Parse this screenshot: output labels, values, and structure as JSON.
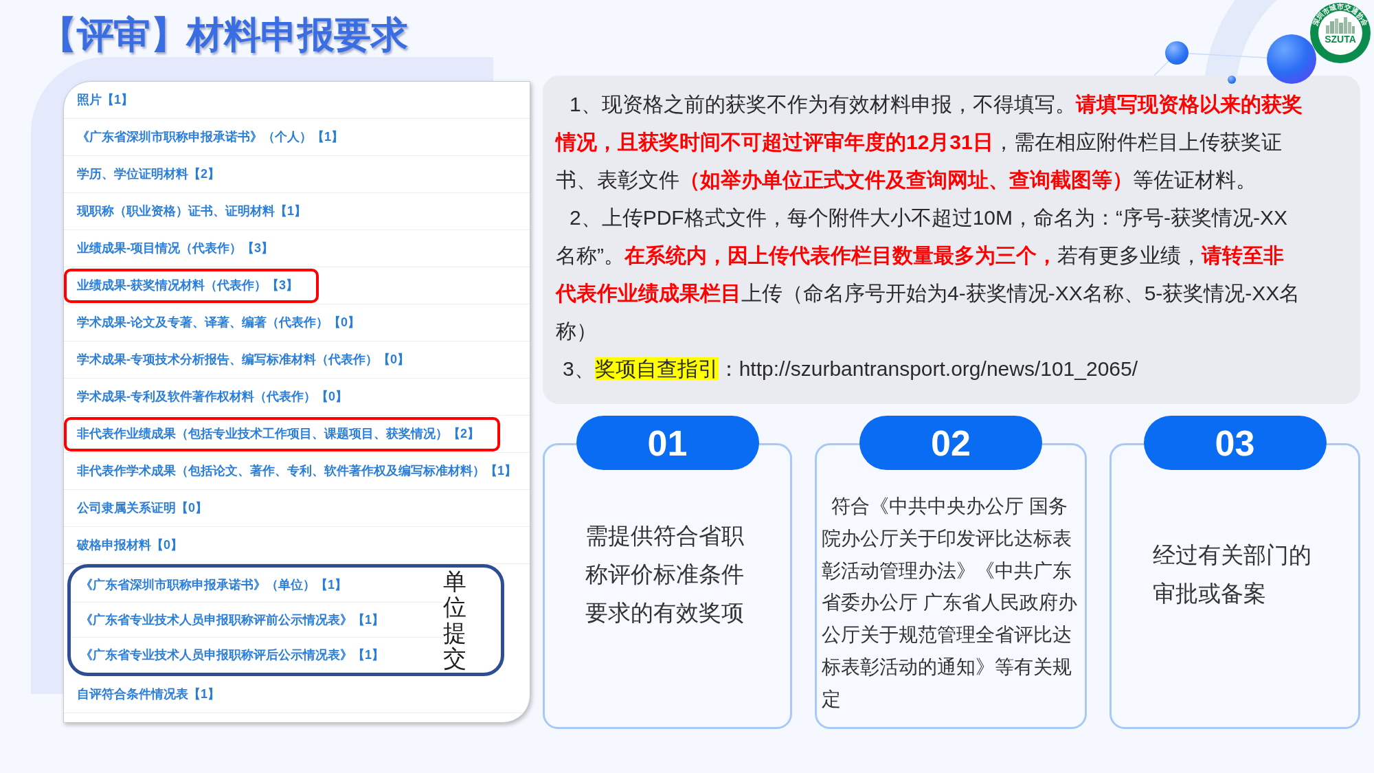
{
  "title": "【评审】材料申报要求",
  "logo": {
    "name": "深圳市城市交通协会",
    "abbreviation": "SZUTA"
  },
  "attachment_list": {
    "items": [
      {
        "kind": "row",
        "text": "照片【1】",
        "highlighted": false
      },
      {
        "kind": "row",
        "text": "《广东省深圳市职称申报承诺书》（个人）【1】",
        "highlighted": false
      },
      {
        "kind": "row",
        "text": "学历、学位证明材料【2】",
        "highlighted": false
      },
      {
        "kind": "row",
        "text": "现职称（职业资格）证书、证明材料【1】",
        "highlighted": false
      },
      {
        "kind": "row",
        "text": "业绩成果-项目情况（代表作）【3】",
        "highlighted": false
      },
      {
        "kind": "row",
        "text": "业绩成果-获奖情况材料（代表作）【3】",
        "highlighted": true
      },
      {
        "kind": "row",
        "text": "学术成果-论文及专著、译著、编著（代表作）【0】",
        "highlighted": false
      },
      {
        "kind": "row",
        "text": "学术成果-专项技术分析报告、编写标准材料（代表作）【0】",
        "highlighted": false
      },
      {
        "kind": "row",
        "text": "学术成果-专利及软件著作权材料（代表作）【0】",
        "highlighted": false
      },
      {
        "kind": "row",
        "text": "非代表作业绩成果（包括专业技术工作项目、课题项目、获奖情况）【2】",
        "highlighted": true
      },
      {
        "kind": "row",
        "text": "非代表作学术成果（包括论文、著作、专利、软件著作权及编写标准材料）【1】",
        "highlighted": false
      },
      {
        "kind": "row",
        "text": "公司隶属关系证明【0】",
        "highlighted": false
      },
      {
        "kind": "row",
        "text": "破格申报材料【0】",
        "highlighted": false
      },
      {
        "kind": "group",
        "label": "单位提交",
        "items": [
          {
            "text": "《广东省深圳市职称申报承诺书》（单位）【1】",
            "highlighted": false
          },
          {
            "text": "《广东省专业技术人员申报职称评前公示情况表》【1】",
            "highlighted": false
          },
          {
            "text": "《广东省专业技术人员申报职称评后公示情况表》【1】",
            "highlighted": false
          }
        ]
      },
      {
        "kind": "row",
        "text": "自评符合条件情况表【1】",
        "highlighted": false
      }
    ]
  },
  "notes": {
    "paragraphs": [
      {
        "kind": "plain",
        "text": "1、现资格之前的获奖不作为有效材料申报，不得填写。**请填写现资格以来的获奖情况，且获奖时间不可超过评审年度的12月31日**，需在相应附件栏目上传获奖证书、表彰文件**（如举办单位正式文件及查询网址、查询截图等）**等佐证材料。"
      },
      {
        "kind": "plain",
        "text": "2、上传PDF格式文件，每个附件大小不超过10M，命名为：“序号-获奖情况-XX名称”。**在系统内，因上传代表作栏目数量最多为三个，**若有更多业绩，**请转至非代表作业绩成果栏目**上传（命名序号开始为4-获奖情况-XX名称、5-获奖情况-XX名称）"
      },
      {
        "kind": "highlight",
        "before": "3、",
        "highlight": "奖项自查指引",
        "after": "：http://szurbantransport.org/news/101_2065/"
      }
    ]
  },
  "cards": [
    {
      "number": "01",
      "text": "需提供符合省职称评价标准条件要求的有效奖项"
    },
    {
      "number": "02",
      "text": "符合《中共中央办公厅 国务院办公厅关于印发评比达标表彰活动管理办法》《中共广东省委办公厅 广东省人民政府办公厅关于规范管理全省评比达标表彰活动的通知》等有关规定"
    },
    {
      "number": "03",
      "text": "经过有关部门的审批或备案"
    }
  ]
}
